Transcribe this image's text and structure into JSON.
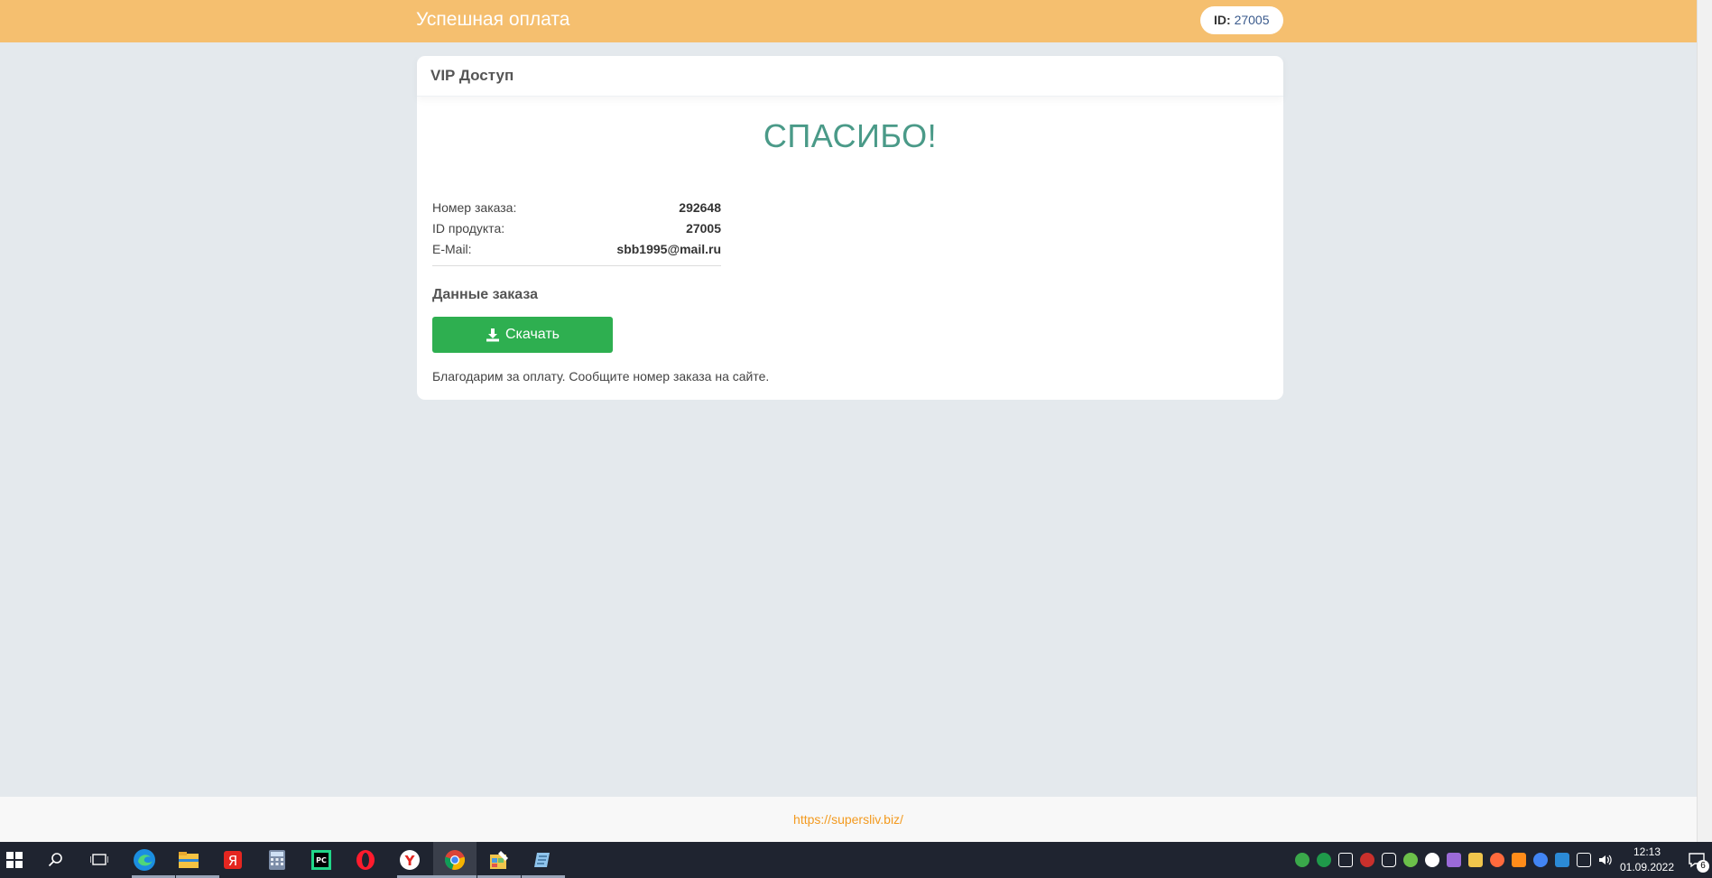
{
  "header": {
    "title": "Успешная оплата",
    "id_label": "ID:",
    "id_value": "27005"
  },
  "card": {
    "title": "VIP Доступ",
    "thanks": "СПАСИБО!",
    "info": [
      {
        "label": "Номер заказа:",
        "value": "292648"
      },
      {
        "label": "ID продукта:",
        "value": "27005"
      },
      {
        "label": "E-Mail:",
        "value": "sbb1995@mail.ru"
      }
    ],
    "order_heading": "Данные заказа",
    "download_label": "Скачать",
    "note": "Благодарим за оплату. Сообщите номер заказа на сайте."
  },
  "footer": {
    "link": "https://supersliv.biz/"
  },
  "taskbar": {
    "time": "12:13",
    "date": "01.09.2022",
    "notifications": "6",
    "apps": [
      "start-icon",
      "search-icon",
      "task-view-icon",
      "edge-icon",
      "file-explorer-icon",
      "yandex-icon",
      "calculator-icon",
      "pycharm-icon",
      "opera-icon",
      "yandex-browser-icon",
      "chrome-icon",
      "paint-icon",
      "notepad-icon"
    ]
  },
  "colors": {
    "header_bg": "#f5bf6f",
    "accent_green": "#2eaf50",
    "thanks_color": "#4a9a88",
    "link_color": "#f39a1f",
    "page_bg": "#e4e9ed"
  }
}
